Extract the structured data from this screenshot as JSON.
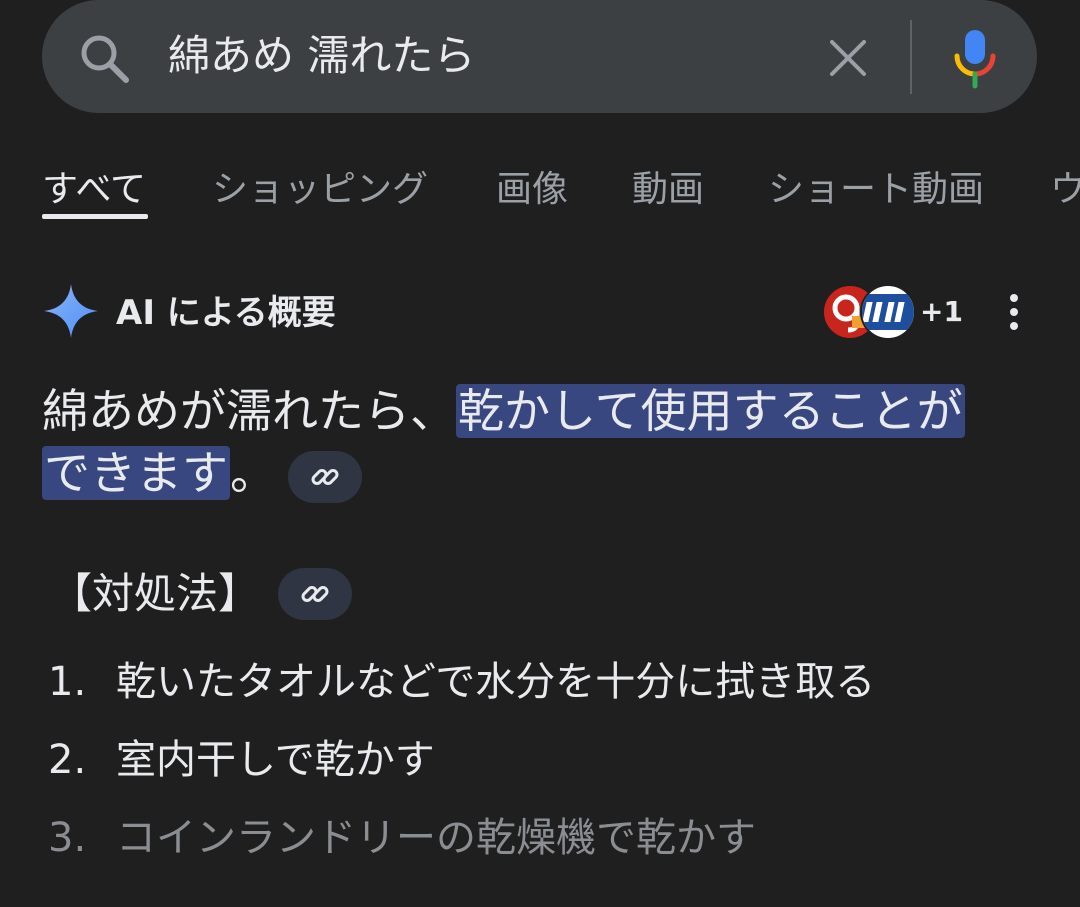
{
  "search": {
    "query": "綿あめ 濡れたら"
  },
  "tabs": [
    {
      "label": "すべて",
      "active": true
    },
    {
      "label": "ショッピング"
    },
    {
      "label": "画像"
    },
    {
      "label": "動画"
    },
    {
      "label": "ショート動画"
    },
    {
      "label": "ウ"
    }
  ],
  "ai_overview": {
    "title": "AI による概要",
    "sources_more": "+1",
    "answer_plain": "綿あめが濡れたら、",
    "answer_highlight_1": "乾かして使用することが",
    "answer_highlight_2": "できます",
    "answer_end": "。",
    "section_title": "【対処法】",
    "steps": [
      {
        "num": "1.",
        "text": "乾いたタオルなどで水分を十分に拭き取る"
      },
      {
        "num": "2.",
        "text": "室内干しで乾かす"
      },
      {
        "num": "3.",
        "text": "コインランドリーの乾燥機で乾かす"
      }
    ]
  },
  "colors": {
    "background": "#1f1f1f",
    "search_bg": "#3c4043",
    "highlight": "#394781",
    "chip": "#303543"
  }
}
